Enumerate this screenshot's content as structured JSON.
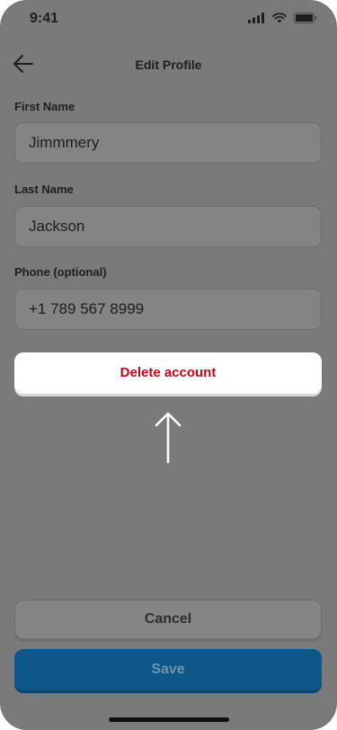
{
  "status_bar": {
    "time": "9:41"
  },
  "header": {
    "title": "Edit Profile"
  },
  "form": {
    "first_name": {
      "label": "First Name",
      "value": "Jimmmery"
    },
    "last_name": {
      "label": "Last Name",
      "value": "Jackson"
    },
    "phone": {
      "label": "Phone (optional)",
      "value": "+1 789 567 8999"
    }
  },
  "actions": {
    "delete_label": "Delete account",
    "cancel_label": "Cancel",
    "save_label": "Save"
  },
  "icons": {
    "back": "arrow-left-icon",
    "hint": "arrow-up-icon",
    "signal": "cellular-signal-icon",
    "wifi": "wifi-icon",
    "battery": "battery-icon"
  },
  "colors": {
    "overlay": "#7a7a7a",
    "delete_text": "#d0021b",
    "save_button": "#0d5888"
  }
}
